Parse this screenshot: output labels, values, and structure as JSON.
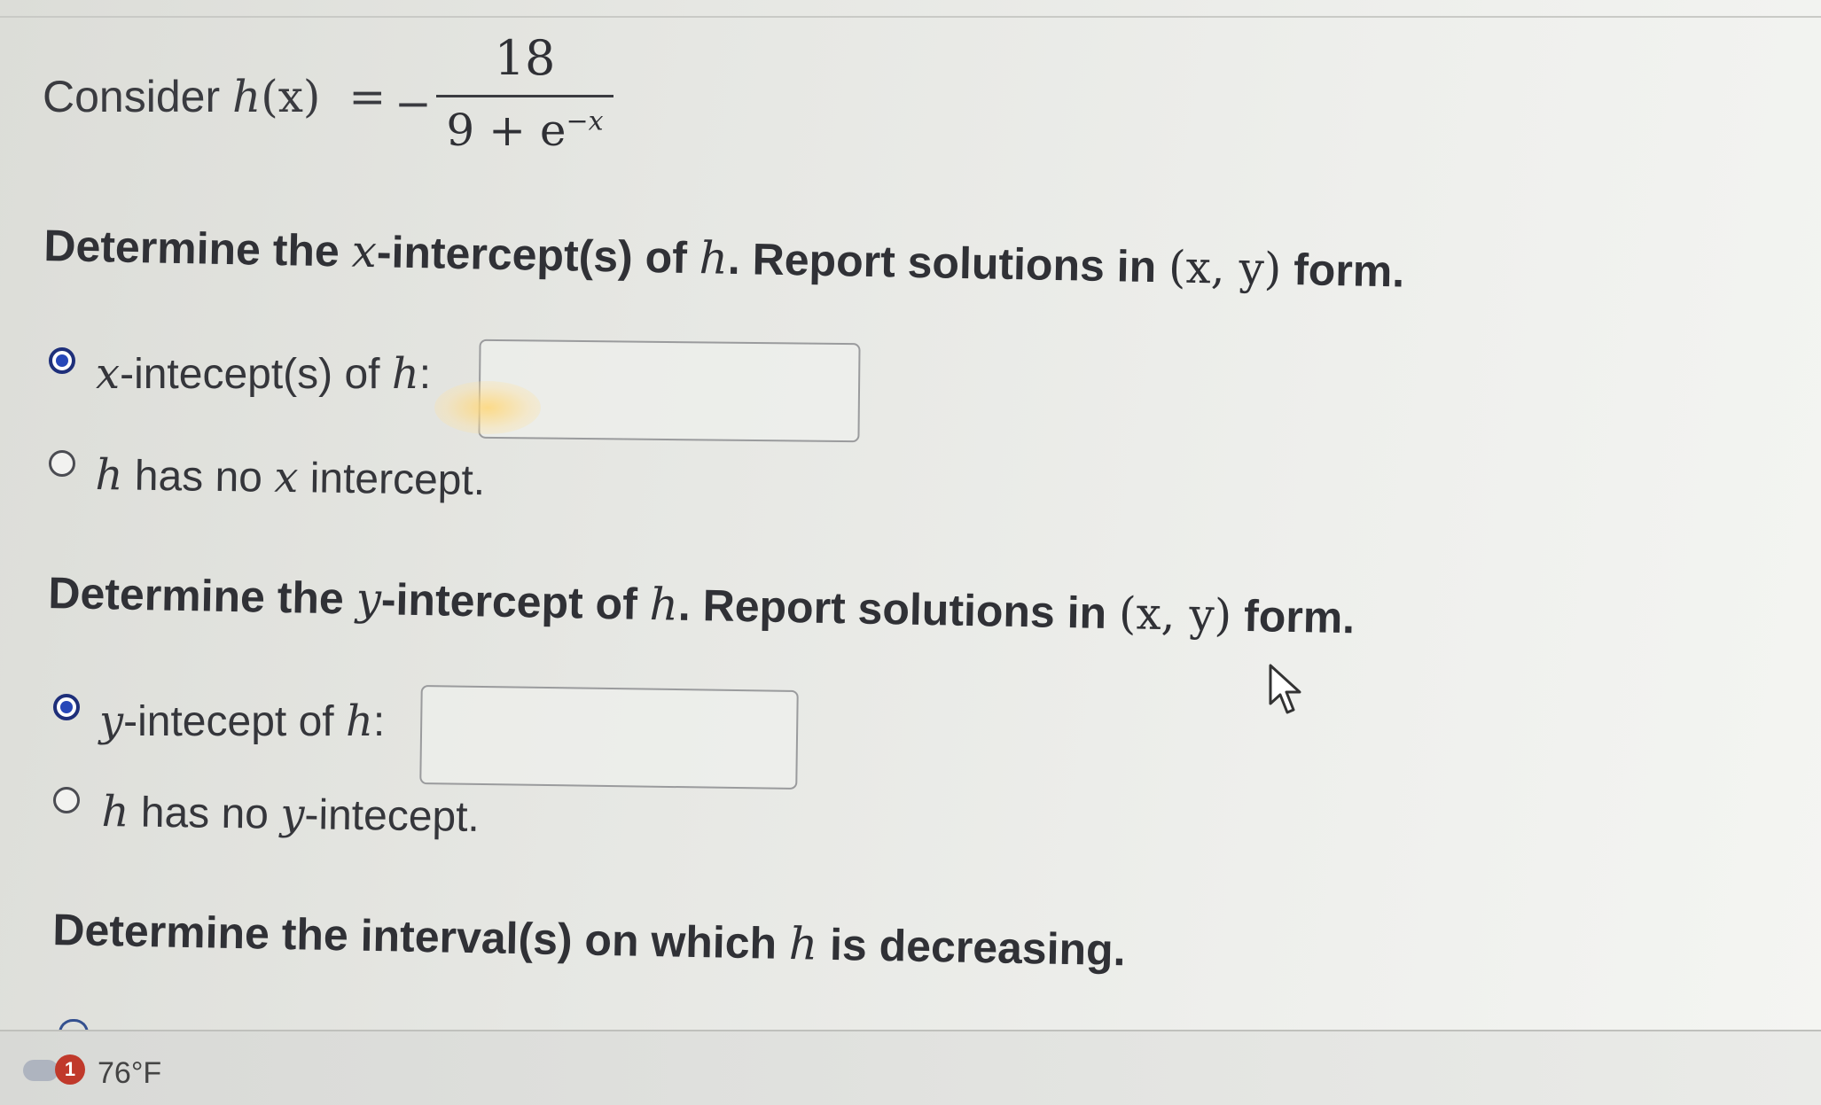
{
  "problem": {
    "consider_label": "Consider",
    "func_name": "h",
    "func_var": "(x)",
    "equals": "=",
    "minus": "−",
    "numerator": "18",
    "denominator_base": "9 + e",
    "denominator_exp": "−x"
  },
  "x_intercept": {
    "prompt_pre": "Determine the ",
    "prompt_var": "x",
    "prompt_mid": "-intercept(s) of ",
    "prompt_h": "h",
    "prompt_post": ". Report solutions in ",
    "prompt_form": "(x, y)",
    "prompt_end": " form.",
    "option1_var": "x",
    "option1_text": "-intecept(s) of ",
    "option1_h": "h",
    "option1_colon": ":",
    "option1_value": "",
    "option1_selected": true,
    "option2_h": "h",
    "option2_text": " has no ",
    "option2_var": "x",
    "option2_end": " intercept.",
    "option2_selected": false
  },
  "y_intercept": {
    "prompt_pre": "Determine the ",
    "prompt_var": "y",
    "prompt_mid": "-intercept of ",
    "prompt_h": "h",
    "prompt_post": ". Report solutions in ",
    "prompt_form": "(x, y)",
    "prompt_end": " form.",
    "option1_var": "y",
    "option1_text": "-intecept of ",
    "option1_h": "h",
    "option1_colon": ":",
    "option1_value": "",
    "option1_selected": true,
    "option2_h": "h",
    "option2_text": " has no ",
    "option2_var": "y",
    "option2_end": "-intecept.",
    "option2_selected": false
  },
  "decreasing": {
    "prompt_pre": "Determine the interval(s) on which ",
    "prompt_h": "h",
    "prompt_end": " is decreasing."
  },
  "taskbar": {
    "notification_count": "1",
    "temperature": "76°F"
  },
  "colors": {
    "radio_selected": "#2747b8",
    "background": "#e4e5e1"
  }
}
